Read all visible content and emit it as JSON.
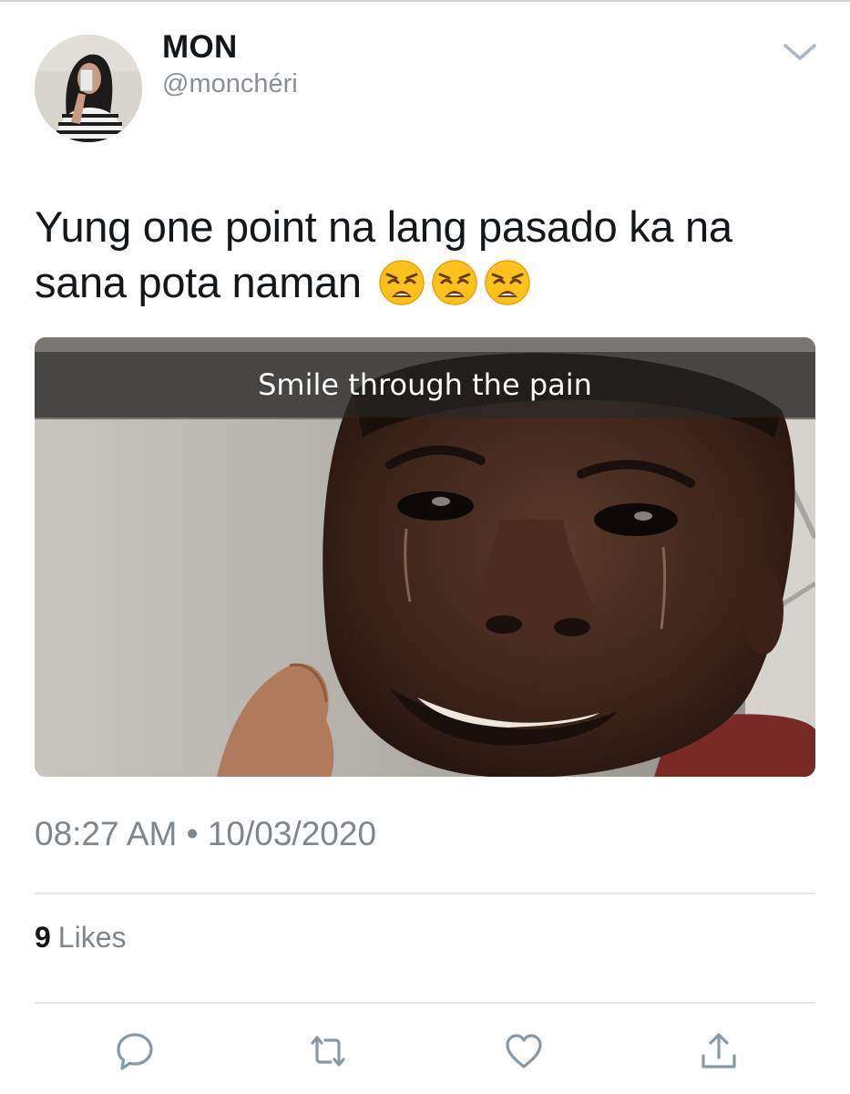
{
  "tweet": {
    "display_name": "MON",
    "handle": "@monchéri",
    "text_line1": "Yung one point na lang pasado ka na",
    "text_line2": "sana pota naman",
    "emoji": "weary-face",
    "emoji_count": 3,
    "media": {
      "caption": "Smile through the pain"
    },
    "timestamp": "08:27 AM • 10/03/2020",
    "likes_count": "9",
    "likes_label": "Likes"
  },
  "icons": {
    "menu": "chevron-down-icon",
    "reply": "reply-icon",
    "retweet": "retweet-icon",
    "like": "heart-icon",
    "share": "share-icon"
  },
  "colors": {
    "text": "#14171a",
    "secondary": "#7f868c",
    "icon": "#8899a6",
    "divider": "#e3e6e8"
  }
}
